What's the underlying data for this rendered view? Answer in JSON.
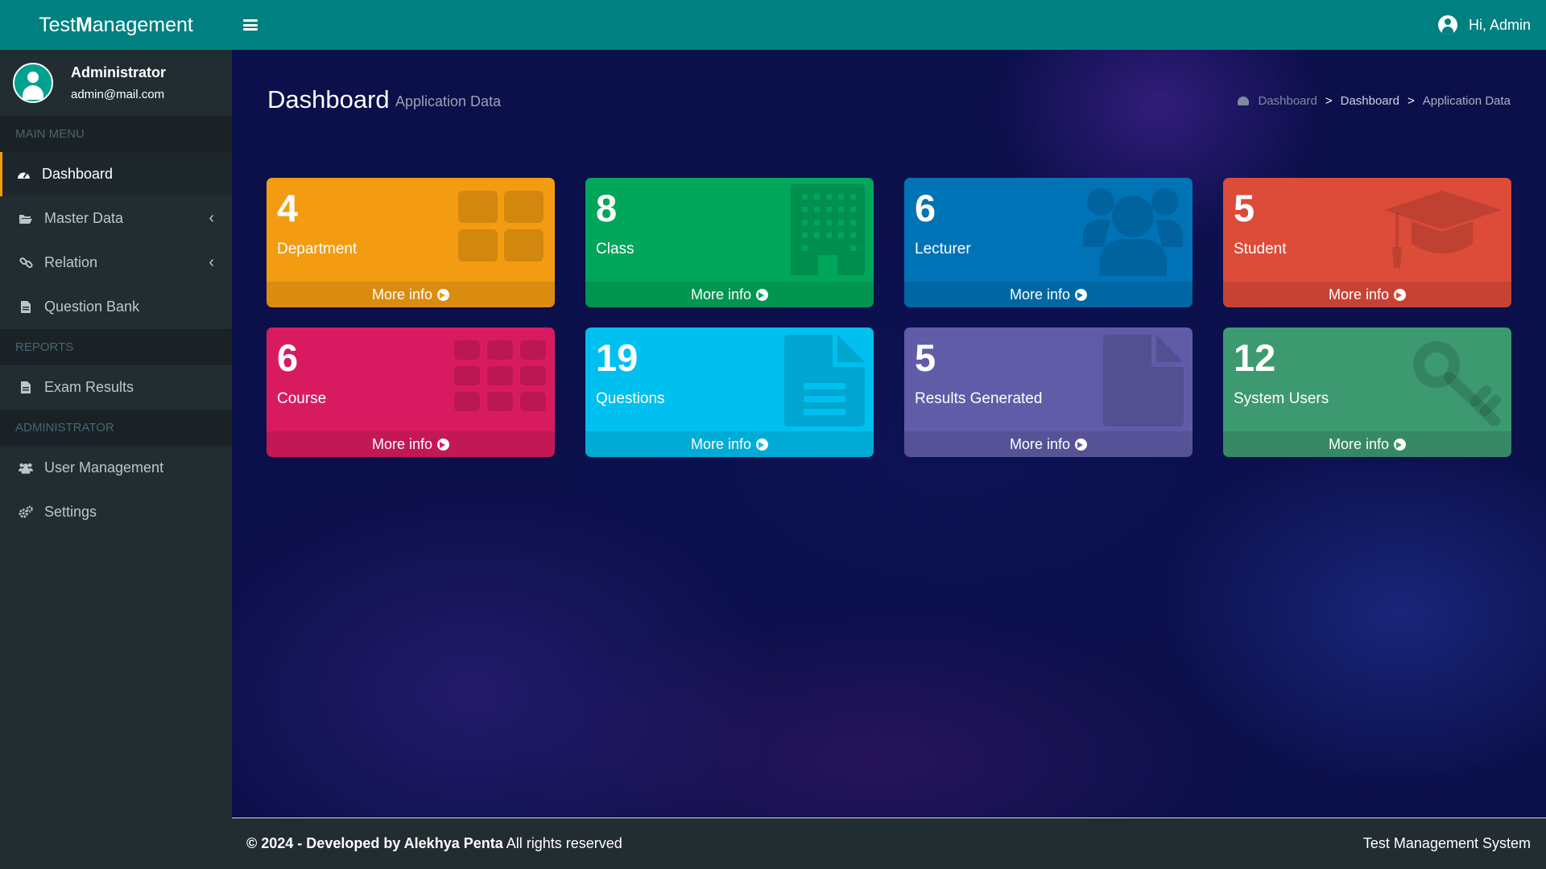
{
  "header": {
    "logo_light": "Test ",
    "logo_bold": "M",
    "logo_rest": "anagement",
    "user_greeting": "Hi, Admin"
  },
  "sidebar": {
    "user_name": "Administrator",
    "user_email": "admin@mail.com",
    "sections": [
      {
        "title": "MAIN MENU"
      },
      {
        "title": "REPORTS"
      },
      {
        "title": "ADMINISTRATOR"
      }
    ],
    "items": [
      {
        "label": "Dashboard",
        "icon": "dashboard-icon",
        "active": true
      },
      {
        "label": "Master Data",
        "icon": "folder-open-icon",
        "chevron": true
      },
      {
        "label": "Relation",
        "icon": "link-icon",
        "chevron": true
      },
      {
        "label": "Question Bank",
        "icon": "file-text-icon"
      },
      {
        "label": "Exam Results",
        "icon": "file-icon"
      },
      {
        "label": "User Management",
        "icon": "users-icon"
      },
      {
        "label": "Settings",
        "icon": "cogs-icon"
      }
    ]
  },
  "content": {
    "title": "Dashboard",
    "subtitle": "Application Data",
    "breadcrumb": [
      "Dashboard",
      ">",
      "Dashboard",
      ">",
      "Application Data"
    ]
  },
  "boxes": [
    {
      "count": "4",
      "label": "Department",
      "more": "More info",
      "color": "#f39c12",
      "icon": "th-large-icon"
    },
    {
      "count": "8",
      "label": "Class",
      "more": "More info",
      "color": "#00a65a",
      "icon": "building-icon"
    },
    {
      "count": "6",
      "label": "Lecturer",
      "more": "More info",
      "color": "#0073b7",
      "icon": "users-icon"
    },
    {
      "count": "5",
      "label": "Student",
      "more": "More info",
      "color": "#dd4b39",
      "icon": "graduation-cap-icon"
    },
    {
      "count": "6",
      "label": "Course",
      "more": "More info",
      "color": "#d81b60",
      "icon": "th-icon"
    },
    {
      "count": "19",
      "label": "Questions",
      "more": "More info",
      "color": "#00c0ef",
      "icon": "file-text-icon"
    },
    {
      "count": "5",
      "label": "Results Generated",
      "more": "More info",
      "color": "#605ca8",
      "icon": "file-icon"
    },
    {
      "count": "12",
      "label": "System Users",
      "more": "More info",
      "color": "#3d9970",
      "icon": "key-icon"
    }
  ],
  "footer": {
    "copyright": "© 2024 - Developed by Alekhya Penta",
    "rights": " All rights reserved",
    "app_name": "Test Management System"
  }
}
